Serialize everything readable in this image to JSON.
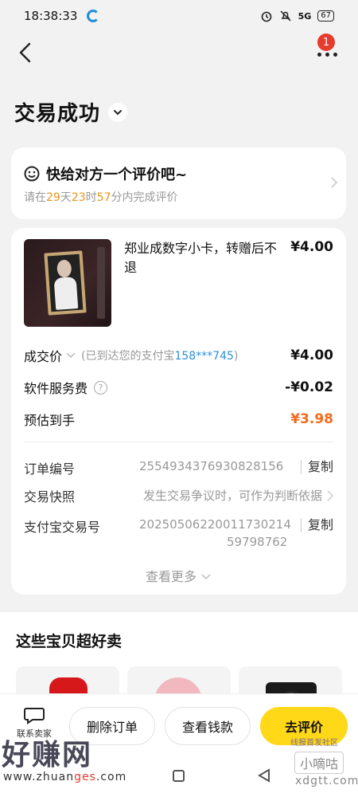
{
  "status_bar": {
    "time": "18:38:33",
    "network": "5G",
    "battery": "67"
  },
  "nav": {
    "notification_count": "1"
  },
  "page_title": "交易成功",
  "review": {
    "heading": "快给对方一个评价吧~",
    "sub_prefix": "请在",
    "days": "29",
    "days_unit": "天",
    "hours": "23",
    "hours_unit": "时",
    "minutes": "57",
    "sub_suffix": "分内完成评价"
  },
  "order": {
    "product_title": "郑业成数字小卡，转赠后不退",
    "product_price": "¥4.00",
    "deal_price_label": "成交价",
    "deal_price_note_prefix": "(已到达您的支付宝",
    "deal_price_note_account": "158***745",
    "deal_price_note_suffix": ")",
    "deal_price": "¥4.00",
    "service_fee_label": "软件服务费",
    "service_fee": "-¥0.02",
    "estimated_label": "预估到手",
    "estimated": "¥3.98",
    "order_no_label": "订单编号",
    "order_no": "2554934376930828156",
    "copy_label": "复制",
    "snapshot_label": "交易快照",
    "snapshot_hint": "发生交易争议时，可作为判断依据",
    "alipay_no_label": "支付宝交易号",
    "alipay_no_line1": "20250506220011730214",
    "alipay_no_line2": "59798762",
    "see_more": "查看更多"
  },
  "recommend": {
    "title": "这些宝贝超好卖"
  },
  "bottom_bar": {
    "kefu_label": "联系卖家",
    "delete_order": "删除订单",
    "view_money": "查看钱款",
    "go_review": "去评价"
  },
  "watermark": {
    "brand": "好赚网",
    "url_prefix": "www.zhuan",
    "url_highlight": "ges",
    "url_suffix": ".com",
    "right_top": "线报首发社区",
    "right_mid": "小嘀咕",
    "right_bottom": "xdgtt.com"
  },
  "colors": {
    "accent": "#ffd817",
    "orange": "#f36b1c",
    "countdown": "#e89418",
    "link": "#2f8fd8"
  }
}
